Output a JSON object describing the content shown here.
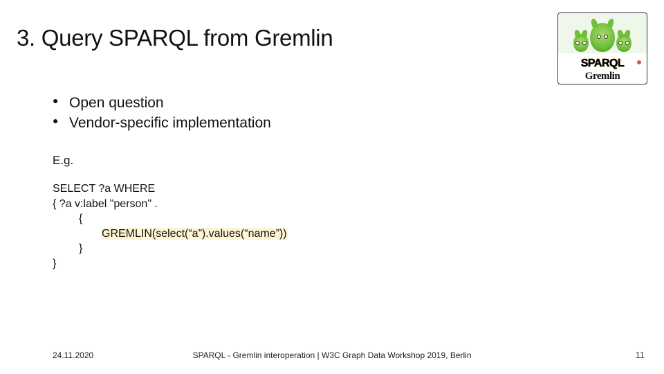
{
  "title": "3. Query SPARQL from Gremlin",
  "logo": {
    "sparql_label": "SPARQL",
    "gremlin_label": "Gremlin"
  },
  "bullets": {
    "items": [
      {
        "text": "Open question"
      },
      {
        "text": "Vendor-specific implementation"
      }
    ]
  },
  "example_label": "E.g.",
  "code": {
    "l1": "SELECT ?a  WHERE",
    "l2": "{ ?a v:label \"person\" .",
    "l3": "{",
    "l4": "GREMLIN(select(“a”).values(“name”))",
    "l5": "}",
    "l6": "}"
  },
  "footer": {
    "date": "24.11.2020",
    "center": "SPARQL - Gremlin interoperation | W3C Graph Data Workshop 2019, Berlin",
    "page": "11"
  }
}
